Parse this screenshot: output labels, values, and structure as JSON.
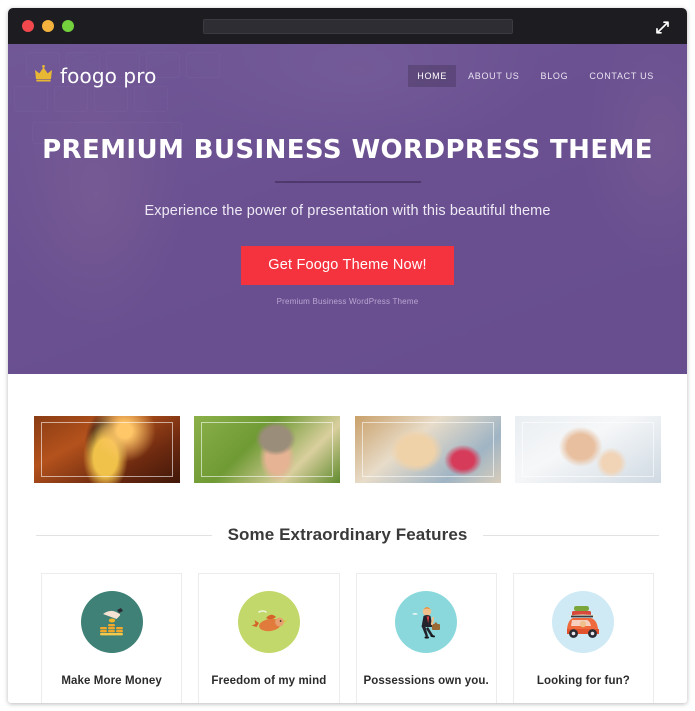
{
  "browser": {
    "traffic_lights": [
      {
        "name": "close",
        "color": "#f0484c"
      },
      {
        "name": "minimize",
        "color": "#f3b23e"
      },
      {
        "name": "maximize",
        "color": "#74d13d"
      }
    ],
    "address_value": "",
    "address_placeholder": "",
    "expand_icon": "expand-arrows-icon"
  },
  "site": {
    "logo": {
      "icon": "crown-icon",
      "text": "foogo pro"
    },
    "menu": [
      {
        "label": "HOME",
        "active": true
      },
      {
        "label": "ABOUT US",
        "active": false
      },
      {
        "label": "BLOG",
        "active": false
      },
      {
        "label": "CONTACT US",
        "active": false
      }
    ]
  },
  "hero": {
    "title": "PREMIUM BUSINESS WORDPRESS THEME",
    "subtitle": "Experience the power of presentation with this beautiful theme",
    "cta_label": "Get Foogo Theme Now!",
    "cta_note": "Premium Business WordPress Theme",
    "overlay_color": "#6a4f92",
    "cta_color": "#f5333f"
  },
  "thumbnails": [
    {
      "name": "thumbnail-woman-autumn",
      "alt": "Woman in yellow scarf with autumn bokeh"
    },
    {
      "name": "thumbnail-woman-hat",
      "alt": "Smiling woman wearing a striped fedora"
    },
    {
      "name": "thumbnail-girl-scarf",
      "alt": "Girl lying down with colorful striped scarf"
    },
    {
      "name": "thumbnail-mother-child",
      "alt": "Mother and child in white winter hats"
    }
  ],
  "features": {
    "heading": "Some Extraordinary Features",
    "cards": [
      {
        "label": "Make More Money",
        "icon": "coins-hand-icon",
        "circle": "#3f8176"
      },
      {
        "label": "Freedom of my mind",
        "icon": "bird-icon",
        "circle": "#c3d86a"
      },
      {
        "label": "Possessions own you.",
        "icon": "businessman-icon",
        "circle": "#8ad8dc"
      },
      {
        "label": "Looking for fun?",
        "icon": "road-trip-car-icon",
        "circle": "#cfeaf5"
      }
    ]
  }
}
